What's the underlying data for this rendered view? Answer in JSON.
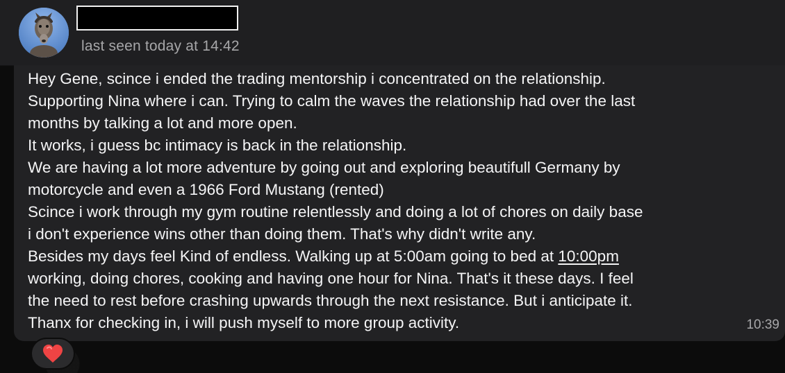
{
  "header": {
    "contact_name": "",
    "status": "last seen today at 14:42"
  },
  "message": {
    "lines": [
      "Hey Gene, scince i ended the trading mentorship i concentrated on the relationship.",
      "Supporting Nina where i can. Trying to calm the waves the relationship had over the last",
      "months by talking a lot and more open.",
      "It works, i guess bc intimacy is back in the relationship.",
      "We are having a lot more adventure by going out and exploring beautifull Germany by",
      "motorcycle and even a 1966 Ford Mustang (rented)",
      "Scince i work through my gym routine relentlessly and doing a lot of chores on daily base",
      "i don't experience wins other than doing them. That's why didn't write any.",
      "Besides my days feel Kind of endless. Walking up at 5:00am going to bed at ",
      "10:00pm",
      "working, doing chores, cooking and having one hour for Nina. That's it these days. I feel",
      "the need to rest before crashing upwards through the next resistance. But i anticipate it.",
      "Thanx for checking in, i will push myself to more group activity."
    ],
    "time": "10:39"
  },
  "reaction": {
    "emoji_name": "red-heart-icon"
  },
  "colors": {
    "header_bg": "#1f1f21",
    "bubble_bg": "#222224",
    "chat_bg": "#0c0c0c",
    "text": "#f5f5f6",
    "muted_text": "#a7a7a9",
    "heart": "#ef4444"
  }
}
